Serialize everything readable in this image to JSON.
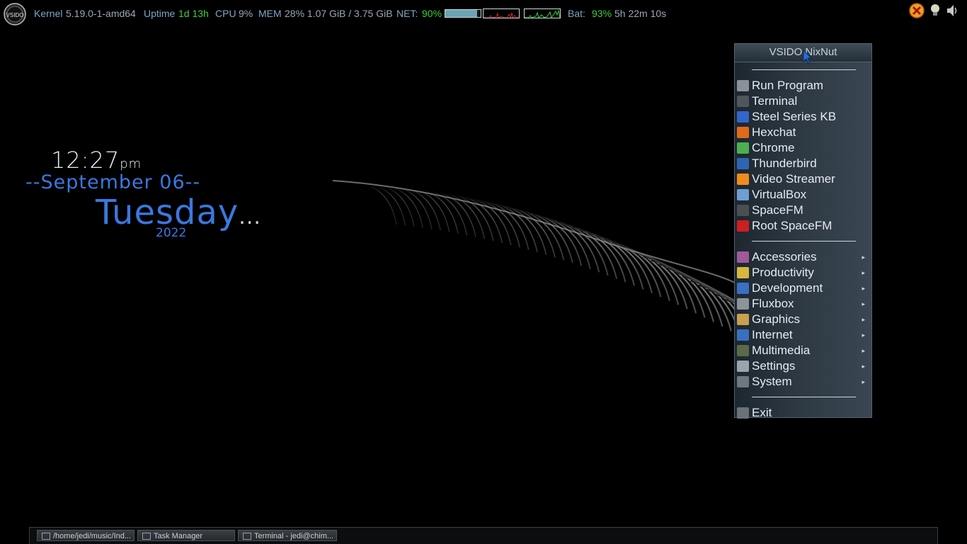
{
  "status_bar": {
    "kernel_label": "Kernel",
    "kernel_value": "5.19.0-1-amd64",
    "uptime_label": "Uptime",
    "uptime_value": "1d 13h",
    "cpu_label": "CPU",
    "cpu_value": "9%",
    "mem_label": "MEM",
    "mem_value": "28% 1.07 GiB / 3.75 GiB",
    "net_label": "NET:",
    "net_value": "90%",
    "net_level": 0.9,
    "bat_label": "Bat:",
    "bat_value": "93%",
    "bat_time": "5h 22m 10s"
  },
  "tray": {
    "icons": [
      "hexchat-icon",
      "bulb-icon",
      "speaker-icon"
    ]
  },
  "clock": {
    "time": "12:27",
    "ampm": "pm",
    "date": "--September 06--",
    "day": "Tuesday",
    "day_suffix": "...",
    "year": "2022"
  },
  "menu": {
    "title": "VSIDO NixNut",
    "apps": [
      {
        "label": "Run Program",
        "icon": "run-program-icon",
        "color": "#8a9298"
      },
      {
        "label": "Terminal",
        "icon": "terminal-icon",
        "color": "#50565c"
      },
      {
        "label": "Steel Series KB",
        "icon": "keyboard-icon",
        "color": "#3366cc"
      },
      {
        "label": "Hexchat",
        "icon": "hexchat-icon",
        "color": "#e06a1a"
      },
      {
        "label": "Chrome",
        "icon": "chrome-icon",
        "color": "#4caf50"
      },
      {
        "label": "Thunderbird",
        "icon": "thunderbird-icon",
        "color": "#2f64b4"
      },
      {
        "label": "Video Streamer",
        "icon": "video-streamer-icon",
        "color": "#f08c1e"
      },
      {
        "label": "VirtualBox",
        "icon": "virtualbox-icon",
        "color": "#6e9ed2"
      },
      {
        "label": "SpaceFM",
        "icon": "spacefm-icon",
        "color": "#4a4f54"
      },
      {
        "label": "Root SpaceFM",
        "icon": "root-spacefm-icon",
        "color": "#cc1f1f"
      }
    ],
    "categories": [
      {
        "label": "Accessories",
        "icon": "accessories-icon",
        "color": "#a05a9a"
      },
      {
        "label": "Productivity",
        "icon": "productivity-icon",
        "color": "#d8b640"
      },
      {
        "label": "Development",
        "icon": "development-icon",
        "color": "#3b6fc4"
      },
      {
        "label": "Fluxbox",
        "icon": "fluxbox-icon",
        "color": "#8c949a"
      },
      {
        "label": "Graphics",
        "icon": "graphics-icon",
        "color": "#c8a050"
      },
      {
        "label": "Internet",
        "icon": "internet-icon",
        "color": "#3a6fc0"
      },
      {
        "label": "Multimedia",
        "icon": "multimedia-icon",
        "color": "#5a6a4a"
      },
      {
        "label": "Settings",
        "icon": "settings-icon",
        "color": "#9aa4ac"
      },
      {
        "label": "System",
        "icon": "system-icon",
        "color": "#70787e"
      }
    ],
    "submenu_arrow": "▸",
    "exit": {
      "label": "Exit",
      "icon": "exit-icon",
      "color": "#6a7278"
    }
  },
  "taskbar": {
    "tasks": [
      {
        "label": "/home/jedi/music/Ind..."
      },
      {
        "label": "Task Manager"
      },
      {
        "label": "Terminal - jedi@chim..."
      }
    ]
  }
}
